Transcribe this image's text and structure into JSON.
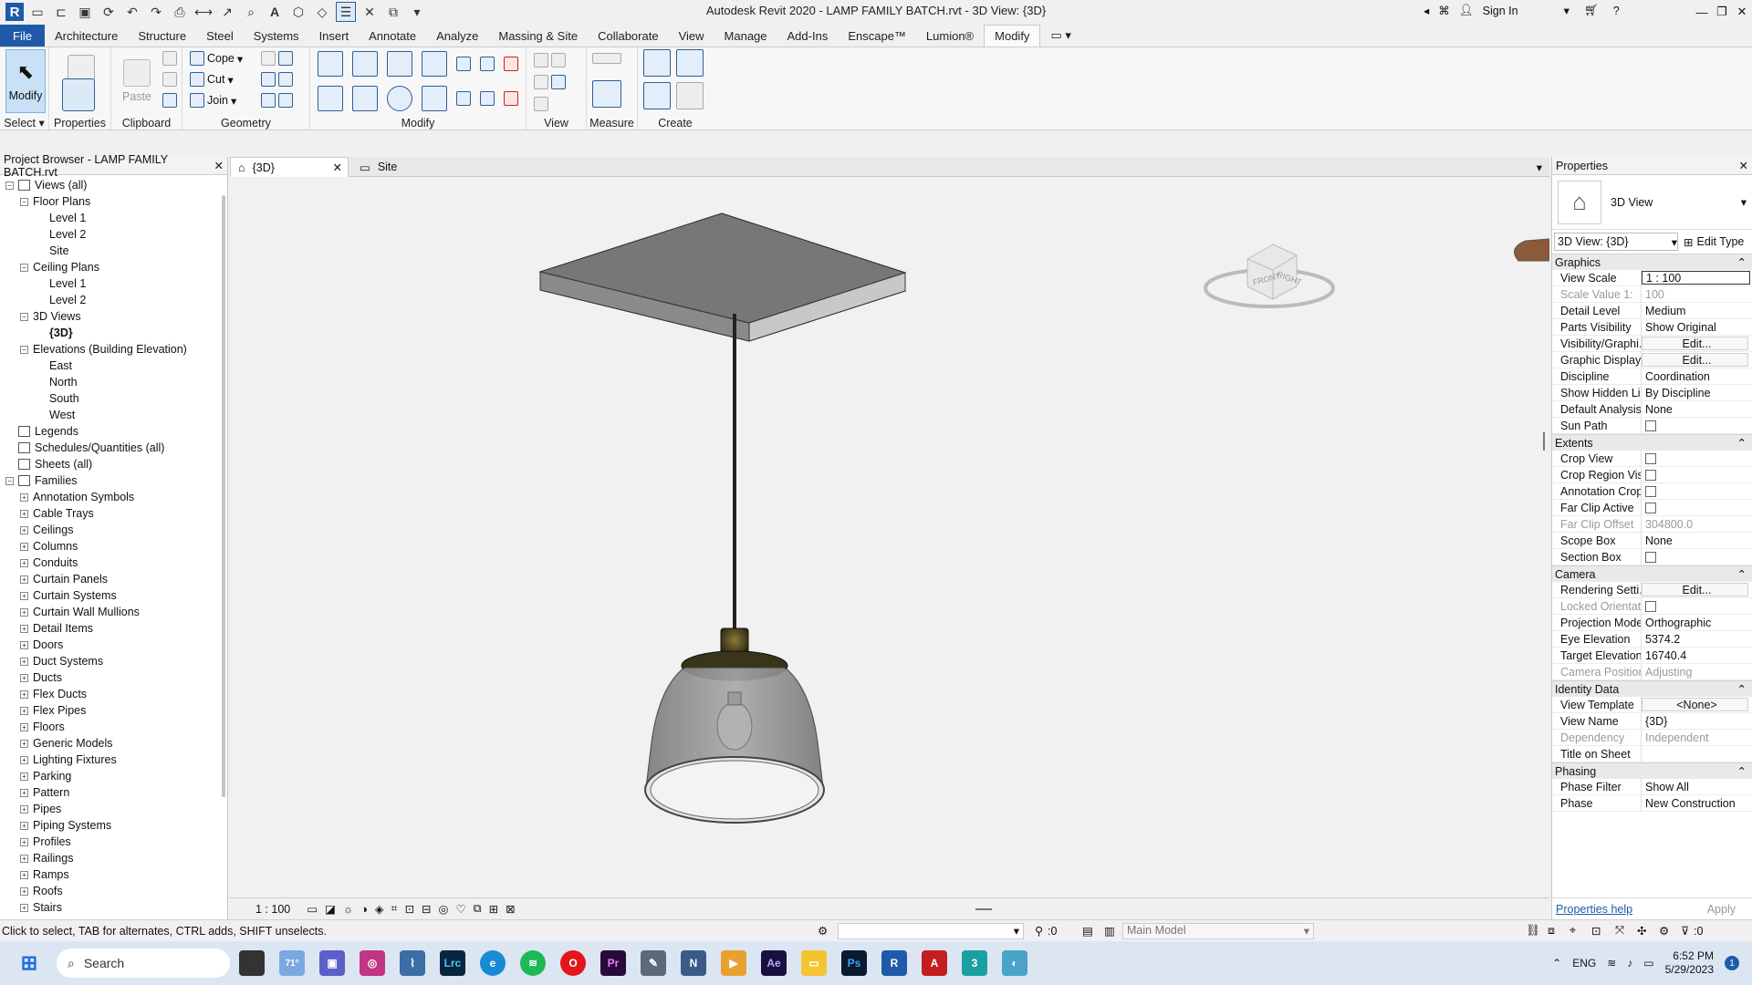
{
  "window": {
    "title": "Autodesk Revit 2020 - LAMP FAMILY BATCH.rvt - 3D View: {3D}",
    "sign_in": "Sign In"
  },
  "ribbon_tabs": [
    "File",
    "Architecture",
    "Structure",
    "Steel",
    "Systems",
    "Insert",
    "Annotate",
    "Analyze",
    "Massing & Site",
    "Collaborate",
    "View",
    "Manage",
    "Add-Ins",
    "Enscape™",
    "Lumion®",
    "Modify"
  ],
  "ribbon": {
    "select_panel": {
      "modify": "Modify",
      "label": "Select ▾"
    },
    "properties_panel": {
      "properties": "Properties"
    },
    "clipboard": {
      "paste": "Paste",
      "label": "Clipboard"
    },
    "geometry": {
      "cope": "Cope",
      "cut": "Cut",
      "join": "Join",
      "label": "Geometry"
    },
    "modify": {
      "label": "Modify"
    },
    "view": {
      "label": "View"
    },
    "measure": {
      "label": "Measure"
    },
    "create": {
      "label": "Create"
    }
  },
  "project_browser": {
    "title": "Project Browser - LAMP FAMILY BATCH.rvt",
    "nodes": [
      {
        "label": "Views (all)",
        "level": 0,
        "toggle": "−"
      },
      {
        "label": "Floor Plans",
        "level": 1,
        "toggle": "−"
      },
      {
        "label": "Level 1",
        "level": 2
      },
      {
        "label": "Level 2",
        "level": 2
      },
      {
        "label": "Site",
        "level": 2
      },
      {
        "label": "Ceiling Plans",
        "level": 1,
        "toggle": "−"
      },
      {
        "label": "Level 1",
        "level": 2
      },
      {
        "label": "Level 2",
        "level": 2
      },
      {
        "label": "3D Views",
        "level": 1,
        "toggle": "−"
      },
      {
        "label": "{3D}",
        "level": 2,
        "bold": true
      },
      {
        "label": "Elevations (Building Elevation)",
        "level": 1,
        "toggle": "−"
      },
      {
        "label": "East",
        "level": 2
      },
      {
        "label": "North",
        "level": 2
      },
      {
        "label": "South",
        "level": 2
      },
      {
        "label": "West",
        "level": 2
      },
      {
        "label": "Legends",
        "level": 0
      },
      {
        "label": "Schedules/Quantities (all)",
        "level": 0
      },
      {
        "label": "Sheets (all)",
        "level": 0
      },
      {
        "label": "Families",
        "level": 0,
        "toggle": "−"
      },
      {
        "label": "Annotation Symbols",
        "level": 1,
        "toggle": "+"
      },
      {
        "label": "Cable Trays",
        "level": 1,
        "toggle": "+"
      },
      {
        "label": "Ceilings",
        "level": 1,
        "toggle": "+"
      },
      {
        "label": "Columns",
        "level": 1,
        "toggle": "+"
      },
      {
        "label": "Conduits",
        "level": 1,
        "toggle": "+"
      },
      {
        "label": "Curtain Panels",
        "level": 1,
        "toggle": "+"
      },
      {
        "label": "Curtain Systems",
        "level": 1,
        "toggle": "+"
      },
      {
        "label": "Curtain Wall Mullions",
        "level": 1,
        "toggle": "+"
      },
      {
        "label": "Detail Items",
        "level": 1,
        "toggle": "+"
      },
      {
        "label": "Doors",
        "level": 1,
        "toggle": "+"
      },
      {
        "label": "Duct Systems",
        "level": 1,
        "toggle": "+"
      },
      {
        "label": "Ducts",
        "level": 1,
        "toggle": "+"
      },
      {
        "label": "Flex Ducts",
        "level": 1,
        "toggle": "+"
      },
      {
        "label": "Flex Pipes",
        "level": 1,
        "toggle": "+"
      },
      {
        "label": "Floors",
        "level": 1,
        "toggle": "+"
      },
      {
        "label": "Generic Models",
        "level": 1,
        "toggle": "+"
      },
      {
        "label": "Lighting Fixtures",
        "level": 1,
        "toggle": "+"
      },
      {
        "label": "Parking",
        "level": 1,
        "toggle": "+"
      },
      {
        "label": "Pattern",
        "level": 1,
        "toggle": "+"
      },
      {
        "label": "Pipes",
        "level": 1,
        "toggle": "+"
      },
      {
        "label": "Piping Systems",
        "level": 1,
        "toggle": "+"
      },
      {
        "label": "Profiles",
        "level": 1,
        "toggle": "+"
      },
      {
        "label": "Railings",
        "level": 1,
        "toggle": "+"
      },
      {
        "label": "Ramps",
        "level": 1,
        "toggle": "+"
      },
      {
        "label": "Roofs",
        "level": 1,
        "toggle": "+"
      },
      {
        "label": "Stairs",
        "level": 1,
        "toggle": "+"
      }
    ]
  },
  "view_tabs": [
    {
      "label": "{3D}",
      "active": true
    },
    {
      "label": "Site",
      "active": false
    }
  ],
  "viewcube": {
    "front": "FRONT",
    "right": "RIGHT"
  },
  "view_control": {
    "scale": "1 : 100",
    "zero": "0"
  },
  "properties": {
    "title": "Properties",
    "type": "3D View",
    "selector": "3D View: {3D}",
    "edit_type": "Edit Type",
    "sections": [
      {
        "name": "Graphics",
        "rows": [
          {
            "k": "View Scale",
            "v": "1 : 100",
            "input": true
          },
          {
            "k": "Scale Value    1:",
            "v": "100",
            "dim": true
          },
          {
            "k": "Detail Level",
            "v": "Medium"
          },
          {
            "k": "Parts Visibility",
            "v": "Show Original"
          },
          {
            "k": "Visibility/Graphi...",
            "v": "Edit...",
            "btn": true
          },
          {
            "k": "Graphic Display...",
            "v": "Edit...",
            "btn": true
          },
          {
            "k": "Discipline",
            "v": "Coordination"
          },
          {
            "k": "Show Hidden Li...",
            "v": "By Discipline"
          },
          {
            "k": "Default Analysis...",
            "v": "None"
          },
          {
            "k": "Sun Path",
            "v": "",
            "cb": true
          }
        ]
      },
      {
        "name": "Extents",
        "rows": [
          {
            "k": "Crop View",
            "v": "",
            "cb": true
          },
          {
            "k": "Crop Region Vis...",
            "v": "",
            "cb": true
          },
          {
            "k": "Annotation Crop",
            "v": "",
            "cb": true
          },
          {
            "k": "Far Clip Active",
            "v": "",
            "cb": true
          },
          {
            "k": "Far Clip Offset",
            "v": "304800.0",
            "dim": true
          },
          {
            "k": "Scope Box",
            "v": "None"
          },
          {
            "k": "Section Box",
            "v": "",
            "cb": true
          }
        ]
      },
      {
        "name": "Camera",
        "rows": [
          {
            "k": "Rendering Setti...",
            "v": "Edit...",
            "btn": true
          },
          {
            "k": "Locked Orientat...",
            "v": "",
            "cb": true,
            "dim": true
          },
          {
            "k": "Projection Mode",
            "v": "Orthographic"
          },
          {
            "k": "Eye Elevation",
            "v": "5374.2"
          },
          {
            "k": "Target Elevation",
            "v": "16740.4"
          },
          {
            "k": "Camera Position",
            "v": "Adjusting",
            "dim": true
          }
        ]
      },
      {
        "name": "Identity Data",
        "rows": [
          {
            "k": "View Template",
            "v": "<None>",
            "btn": true
          },
          {
            "k": "View Name",
            "v": "{3D}"
          },
          {
            "k": "Dependency",
            "v": "Independent",
            "dim": true
          },
          {
            "k": "Title on Sheet",
            "v": ""
          }
        ]
      },
      {
        "name": "Phasing",
        "rows": [
          {
            "k": "Phase Filter",
            "v": "Show All"
          },
          {
            "k": "Phase",
            "v": "New Construction"
          }
        ]
      }
    ],
    "help": "Properties help",
    "apply": "Apply"
  },
  "status": {
    "hint": "Click to select, TAB for alternates, CTRL adds, SHIFT unselects.",
    "count": ":0",
    "model": "Main Model",
    "filter": ":0"
  },
  "taskbar": {
    "search": "Search",
    "weather": "71°",
    "lang": "ENG",
    "time": "6:52 PM",
    "date": "5/29/2023",
    "badge": "1"
  }
}
